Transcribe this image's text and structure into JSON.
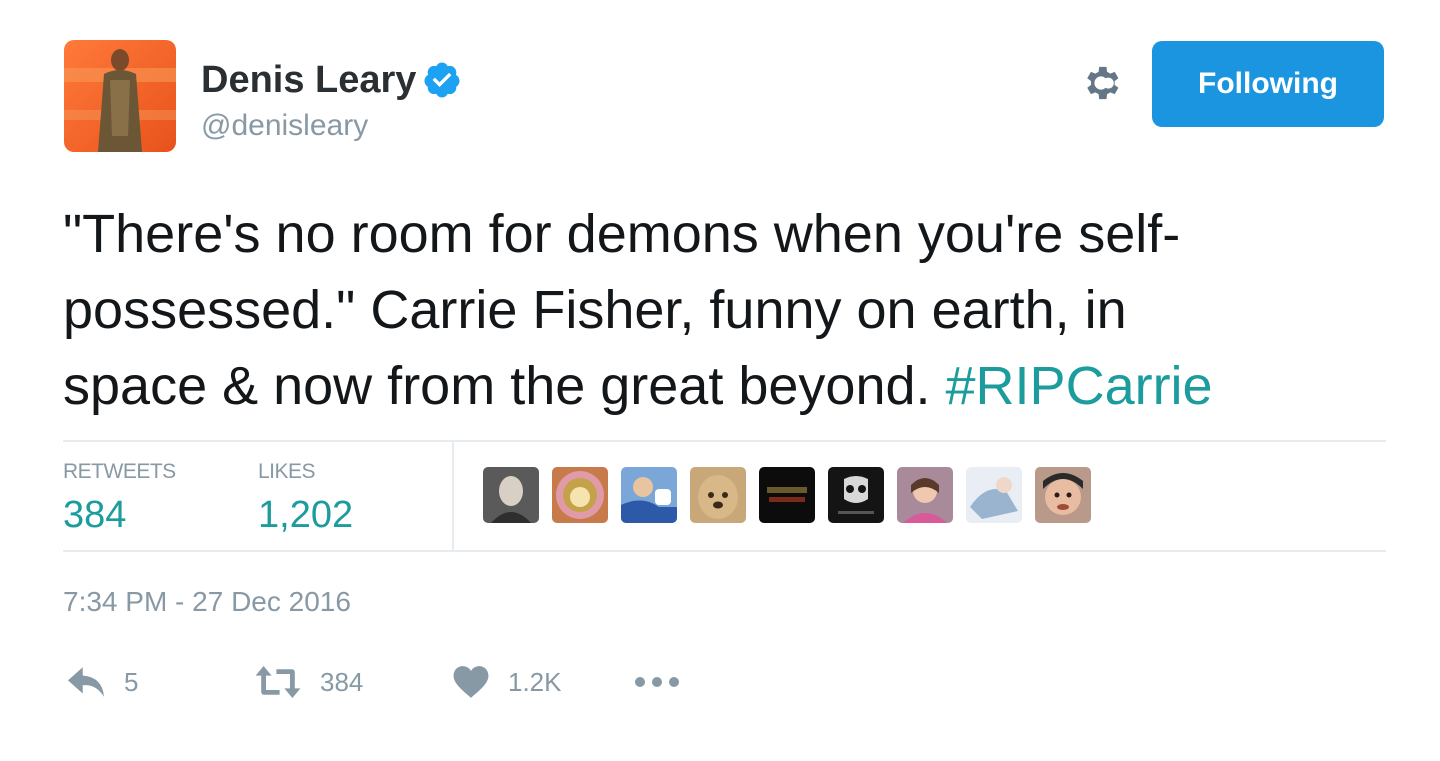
{
  "user": {
    "display_name": "Denis Leary",
    "handle": "@denisleary",
    "verified_icon": "verified-badge-icon",
    "follow_button_label": "Following"
  },
  "tweet": {
    "text_lines": [
      "\"There's no room for demons when you're self-",
      "possessed.\"  Carrie Fisher, funny on earth, in",
      "space & now from the great beyond. "
    ],
    "hashtag": "#RIPCarrie"
  },
  "stats": {
    "retweets_label": "RETWEETS",
    "retweets_value": "384",
    "likes_label": "LIKES",
    "likes_value": "1,202",
    "liker_avatars_count": 9
  },
  "timestamp": "7:34 PM - 27 Dec 2016",
  "actions": {
    "reply_count": "5",
    "retweet_count": "384",
    "like_count": "1.2K"
  },
  "colors": {
    "accent": "#1b95e0",
    "hashtag": "#1c9c9c",
    "muted": "#8899a6",
    "text": "#14171a"
  }
}
